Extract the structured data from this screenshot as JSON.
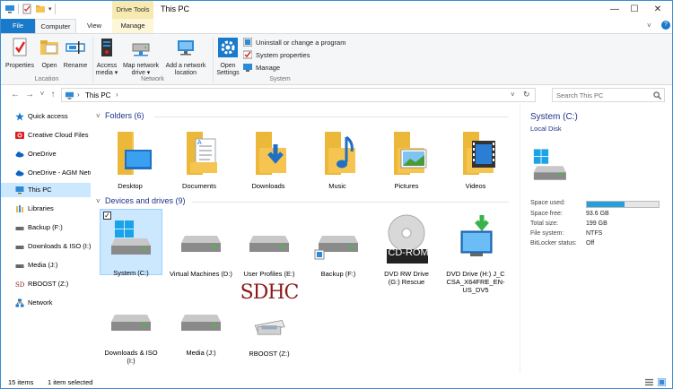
{
  "window": {
    "title": "This PC",
    "context_tab_group": "Drive Tools",
    "controls": {
      "minimize": "—",
      "maximize": "☐",
      "close": "✕"
    }
  },
  "ribbon_tabs": [
    {
      "label": "File",
      "active": false
    },
    {
      "label": "Computer",
      "active": true
    },
    {
      "label": "View",
      "active": false
    },
    {
      "label": "Manage",
      "active": false
    }
  ],
  "ribbon": {
    "location_group": {
      "label": "Location",
      "buttons": [
        "Properties",
        "Open",
        "Rename"
      ]
    },
    "network_group": {
      "label": "Network",
      "buttons": [
        {
          "line1": "Access",
          "line2": "media ▾"
        },
        {
          "line1": "Map network",
          "line2": "drive ▾"
        },
        {
          "line1": "Add a network",
          "line2": "location"
        }
      ]
    },
    "system_group": {
      "label": "System",
      "open_settings": {
        "line1": "Open",
        "line2": "Settings"
      },
      "small": [
        "Uninstall or change a program",
        "System properties",
        "Manage"
      ]
    }
  },
  "address": {
    "back": "←",
    "forward": "→",
    "recent": "˅",
    "up": "↑",
    "crumb": "This PC",
    "chevron": "›",
    "dropdown": "˅",
    "refresh": "↻"
  },
  "search": {
    "placeholder": "Search This PC",
    "icon": "search-icon"
  },
  "nav": [
    {
      "label": "Quick access",
      "icon": "star-icon",
      "color": "#1979ca"
    },
    {
      "label": "Creative Cloud Files",
      "icon": "creative-cloud-icon",
      "color": "#da1f26"
    },
    {
      "label": "OneDrive",
      "icon": "cloud-icon",
      "color": "#0b64c0"
    },
    {
      "label": "OneDrive - AGM Netw",
      "icon": "cloud-icon",
      "color": "#0b64c0"
    },
    {
      "label": "This PC",
      "icon": "monitor-icon",
      "color": "#2d8ad6",
      "selected": true
    },
    {
      "label": "Libraries",
      "icon": "library-icon",
      "color": "#e9b949"
    },
    {
      "label": "Backup (F:)",
      "icon": "drive-icon",
      "color": "#555"
    },
    {
      "label": "Downloads & ISO (I:)",
      "icon": "drive-icon",
      "color": "#555"
    },
    {
      "label": "Media (J:)",
      "icon": "drive-icon",
      "color": "#555"
    },
    {
      "label": "RBOOST (Z:)",
      "icon": "sd-card-icon",
      "color": "#8b1a1a"
    },
    {
      "label": "Network",
      "icon": "network-icon",
      "color": "#1979ca"
    }
  ],
  "folders": {
    "heading": "Folders (6)",
    "items": [
      "Desktop",
      "Documents",
      "Downloads",
      "Music",
      "Pictures",
      "Videos"
    ]
  },
  "drives": {
    "heading": "Devices and drives (9)",
    "items": [
      {
        "label": "System (C:)",
        "selected": true
      },
      {
        "label": "Virtual Machines (D:)"
      },
      {
        "label": "User Profiles (E:)"
      },
      {
        "label": "Backup (F:)"
      },
      {
        "label": "DVD RW Drive (G:) Rescue",
        "badge": "CD-ROM"
      },
      {
        "label": "DVD Drive (H:) J_CCSA_X64FRE_EN-US_DV5"
      },
      {
        "label": "Downloads & ISO (I:)"
      },
      {
        "label": "Media (J:)"
      },
      {
        "label": "RBOOST (Z:)",
        "badge": "SDHC"
      }
    ]
  },
  "details": {
    "title": "System (C:)",
    "subtitle": "Local Disk",
    "used_fraction": 0.53,
    "rows": [
      {
        "key": "Space used:",
        "value": ""
      },
      {
        "key": "Space free:",
        "value": "93.6 GB"
      },
      {
        "key": "Total size:",
        "value": "199 GB"
      },
      {
        "key": "File system:",
        "value": "NTFS"
      },
      {
        "key": "BitLocker status:",
        "value": "Off"
      }
    ]
  },
  "status": {
    "items": "15 items",
    "selected": "1 item selected"
  },
  "colors": {
    "accent": "#1979ca",
    "selection": "#cce8ff",
    "heading": "#1e3287",
    "folder": "#f5c451"
  }
}
